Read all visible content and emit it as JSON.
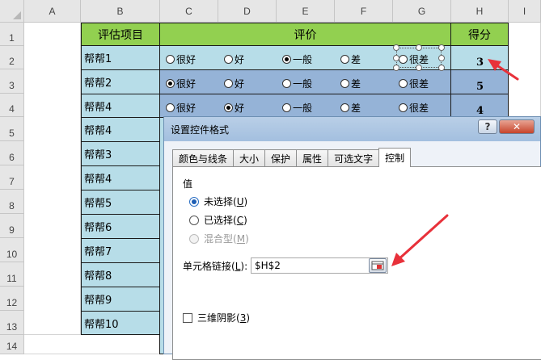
{
  "columns": [
    "A",
    "B",
    "C",
    "D",
    "E",
    "F",
    "G",
    "H",
    "I"
  ],
  "rows": [
    "1",
    "2",
    "3",
    "4",
    "5",
    "6",
    "7",
    "8",
    "9",
    "10",
    "11",
    "12",
    "13",
    "14"
  ],
  "header": {
    "item_label": "评估项目",
    "rating_label": "评价",
    "score_label": "得分"
  },
  "names": [
    "帮帮1",
    "帮帮2",
    "帮帮4",
    "帮帮4",
    "帮帮3",
    "帮帮4",
    "帮帮5",
    "帮帮6",
    "帮帮7",
    "帮帮8",
    "帮帮9",
    "帮帮10"
  ],
  "rating_options": [
    "很好",
    "好",
    "一般",
    "差",
    "很差"
  ],
  "selected_option_index": [
    2,
    0,
    1
  ],
  "scores": [
    "3",
    "5",
    "4"
  ],
  "dialog": {
    "title": "设置控件格式",
    "help_symbol": "?",
    "close_symbol": "✕",
    "tabs": [
      "颜色与线条",
      "大小",
      "保护",
      "属性",
      "可选文字",
      "控制"
    ],
    "active_tab_index": 5,
    "section_label": "值",
    "value_options": [
      {
        "text": "未选择",
        "key": "U",
        "checked": true,
        "disabled": false
      },
      {
        "text": "已选择",
        "key": "C",
        "checked": false,
        "disabled": false
      },
      {
        "text": "混合型",
        "key": "M",
        "checked": false,
        "disabled": true
      }
    ],
    "cell_link_label": "单元格链接",
    "cell_link_key": "L",
    "cell_link_value": "$H$2",
    "shade_label": "三维阴影",
    "shade_key": "3",
    "shade_checked": false
  },
  "colors": {
    "header_green": "#92d050",
    "light_blue": "#b7dde8",
    "mid_blue": "#95b3d7",
    "arrow_red": "#e8313a"
  }
}
